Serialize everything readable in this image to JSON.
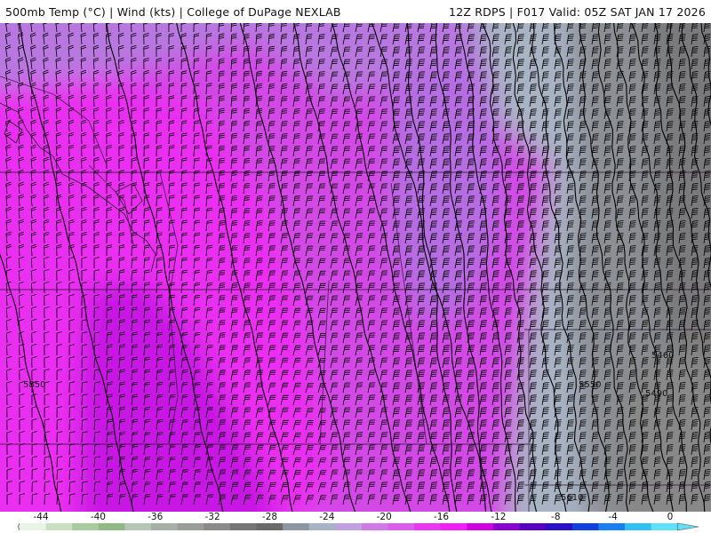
{
  "header": {
    "left": "500mb Temp (°C) | Wind (kts) | College of DuPage NEXLAB",
    "right": "12Z RDPS | F017 Valid: 05Z SAT JAN 17 2026"
  },
  "map": {
    "height_contour_labels": [
      {
        "id": "label-5850",
        "text": "5850"
      },
      {
        "id": "label-5550",
        "text": "5550"
      },
      {
        "id": "label-5460",
        "text": "5460"
      },
      {
        "id": "label-5490",
        "text": "5490"
      },
      {
        "id": "label-5610",
        "text": "5610"
      }
    ]
  },
  "colorbar": {
    "tick_labels": [
      "-44",
      "-40",
      "-36",
      "-32",
      "-28",
      "-24",
      "-20",
      "-16",
      "-12",
      "-8",
      "-4",
      "0"
    ],
    "colors": [
      "#e8f4e6",
      "#c9e0c2",
      "#a8cc9e",
      "#8fba85",
      "#b6c6b6",
      "#a7b0a7",
      "#999c99",
      "#8a8a8a",
      "#767676",
      "#6a6a6a",
      "#8d97a4",
      "#a6b4c6",
      "#c0a0e0",
      "#d07ae8",
      "#dc5cee",
      "#e838f2",
      "#f020f4",
      "#d000e0",
      "#8a00d0",
      "#5a00c0",
      "#2a10c8",
      "#1040e0",
      "#1a80f0",
      "#30c0f4",
      "#60e0f8"
    ]
  }
}
